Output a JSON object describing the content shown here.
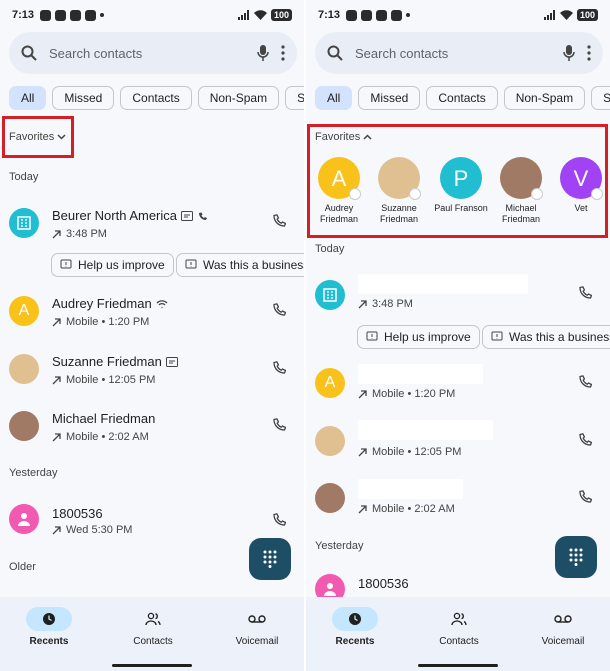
{
  "status": {
    "time": "7:13",
    "battery": "100"
  },
  "search": {
    "placeholder": "Search contacts"
  },
  "chips": [
    "All",
    "Missed",
    "Contacts",
    "Non-Spam",
    "Spa"
  ],
  "favorites": {
    "label": "Favorites",
    "items": [
      {
        "name": "Audrey Friedman",
        "initial": "A",
        "color": "#f9c21a"
      },
      {
        "name": "Suzanne Friedman",
        "initial": "",
        "color": "#e0c090"
      },
      {
        "name": "Paul Franson",
        "initial": "P",
        "color": "#21bdd1"
      },
      {
        "name": "Michael Friedman",
        "initial": "",
        "color": "#a07a64"
      },
      {
        "name": "Vet",
        "initial": "V",
        "color": "#a142f4"
      }
    ]
  },
  "sections": {
    "today": "Today",
    "yesterday": "Yesterday",
    "older": "Older"
  },
  "calls": [
    {
      "name": "Beurer North America",
      "detail": "3:48 PM",
      "color": "#21bdd1"
    },
    {
      "name": "Audrey Friedman",
      "detail": "Mobile • 1:20 PM",
      "initial": "A",
      "color": "#f9c21a"
    },
    {
      "name": "Suzanne Friedman",
      "detail": "Mobile • 12:05 PM",
      "color": "#e0c090"
    },
    {
      "name": "Michael Friedman",
      "detail": "Mobile • 2:02 AM",
      "color": "#a07a64"
    },
    {
      "name": "1800536",
      "detail": "Wed 5:30 PM",
      "color": "#f25ab0"
    }
  ],
  "actions": {
    "help": "Help us improve",
    "business": "Was this a business?"
  },
  "nav": {
    "recents": "Recents",
    "contacts": "Contacts",
    "voicemail": "Voicemail"
  },
  "colors": {
    "accent": "#c4e7ff",
    "fab": "#1e4e65",
    "highlight": "#d41f26"
  }
}
